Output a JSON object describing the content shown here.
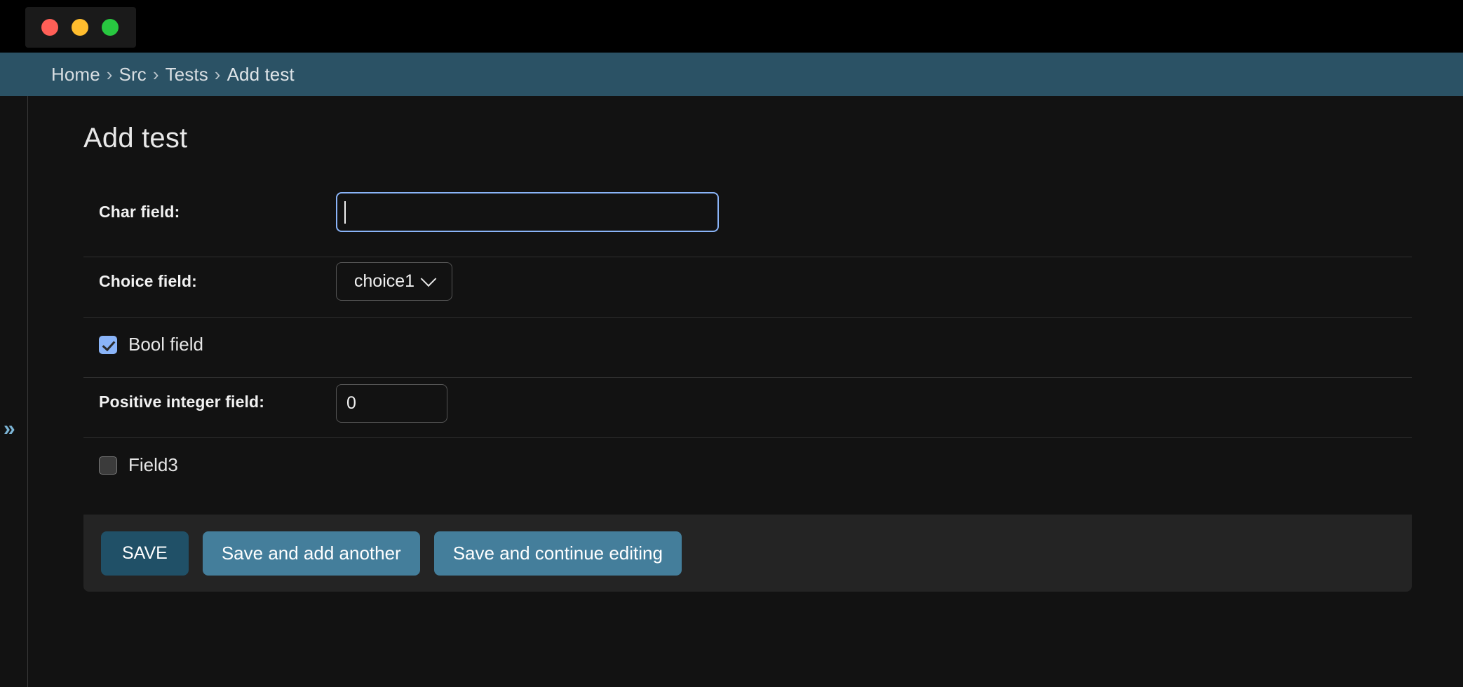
{
  "window": {
    "traffic_lights": [
      {
        "name": "close",
        "color": "#ff5f57"
      },
      {
        "name": "minimize",
        "color": "#ffbd2e"
      },
      {
        "name": "maximize",
        "color": "#28c840"
      }
    ]
  },
  "breadcrumbs": {
    "separator": "›",
    "items": [
      {
        "label": "Home",
        "current": false
      },
      {
        "label": "Src",
        "current": false
      },
      {
        "label": "Tests",
        "current": false
      },
      {
        "label": "Add test",
        "current": true
      }
    ]
  },
  "sidebar": {
    "toggle_icon": "»",
    "toggle_name": "show-sidebar-chevron-icon"
  },
  "page": {
    "title": "Add test"
  },
  "form": {
    "fields": [
      {
        "type": "text",
        "label": "Char field:",
        "value": "",
        "focused": true
      },
      {
        "type": "select",
        "label": "Choice field:",
        "value": "choice1",
        "options": [
          "choice1"
        ]
      },
      {
        "type": "checkbox",
        "label": "Bool field",
        "checked": true
      },
      {
        "type": "number",
        "label": "Positive integer field:",
        "value": "0"
      },
      {
        "type": "checkbox",
        "label": "Field3",
        "checked": false
      }
    ],
    "labels": {
      "char": "Char field:",
      "choice": "Choice field:",
      "bool": "Bool field",
      "positive_integer": "Positive integer field:",
      "field3": "Field3"
    },
    "values": {
      "char": "",
      "choice": "choice1",
      "positive_integer": "0"
    }
  },
  "submit_row": {
    "buttons": [
      {
        "label": "SAVE",
        "style": "primary",
        "color": "#205067"
      },
      {
        "label": "Save and add another",
        "style": "secondary",
        "color": "#447e9b"
      },
      {
        "label": "Save and continue editing",
        "style": "secondary",
        "color": "#447e9b"
      }
    ]
  },
  "colors": {
    "page_background": "#121212",
    "chrome_background": "#000000",
    "breadcrumb_background": "#2b5265",
    "accent_focus": "#8ab4f8",
    "button_primary": "#205067",
    "button_secondary": "#447e9b",
    "submit_row_background": "#242424",
    "divider": "#2e2e2e"
  }
}
